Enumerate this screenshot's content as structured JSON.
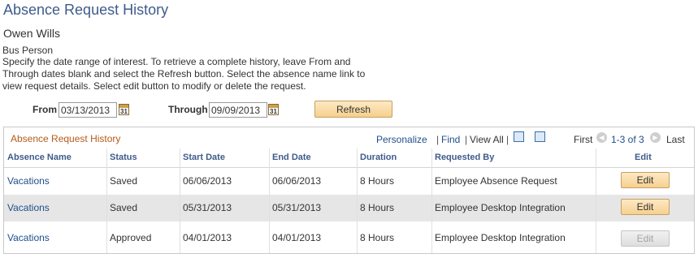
{
  "page": {
    "title": "Absence Request History",
    "person_name": "Owen Wills",
    "person_type": "Bus Person",
    "instructions": "Specify the date range of interest. To retrieve a complete history, leave From and Through dates blank and select the Refresh button. Select the absence name link to view request details. Select edit button to modify or delete the request."
  },
  "filters": {
    "from_label": "From",
    "from_value": "03/13/2013",
    "through_label": "Through",
    "through_value": "09/09/2013",
    "calendar_icon_text": "31",
    "refresh_label": "Refresh"
  },
  "grid": {
    "title": "Absence Request History",
    "personalize": "Personalize",
    "find": "Find",
    "view_all": "View All",
    "sep": "|",
    "first": "First",
    "range": "1-3 of 3",
    "last": "Last",
    "columns": [
      "Absence Name",
      "Status",
      "Start Date",
      "End Date",
      "Duration",
      "Requested By",
      "Edit"
    ],
    "rows": [
      {
        "name": "Vacations",
        "status": "Saved",
        "start": "06/06/2013",
        "end": "06/06/2013",
        "duration": "8 Hours",
        "requested_by": "Employee Absence Request",
        "edit": "Edit",
        "edit_enabled": true
      },
      {
        "name": "Vacations",
        "status": "Saved",
        "start": "05/31/2013",
        "end": "05/31/2013",
        "duration": "8 Hours",
        "requested_by": "Employee Desktop Integration",
        "edit": "Edit",
        "edit_enabled": true
      },
      {
        "name": "Vacations",
        "status": "Approved",
        "start": "04/01/2013",
        "end": "04/01/2013",
        "duration": "8 Hours",
        "requested_by": "Employee Desktop Integration",
        "edit": "Edit",
        "edit_enabled": false
      }
    ]
  }
}
